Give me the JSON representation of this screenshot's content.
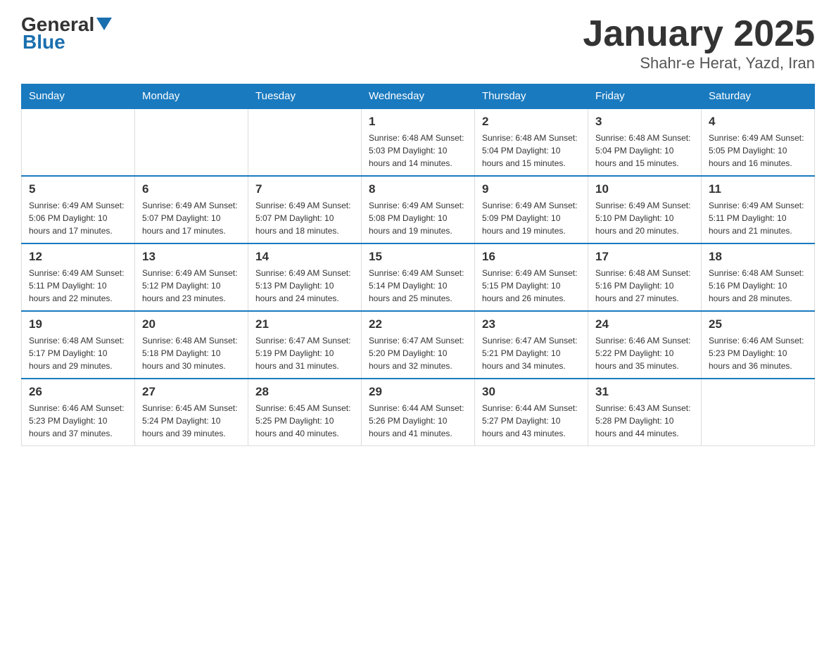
{
  "header": {
    "logo_general": "General",
    "logo_blue": "Blue",
    "title": "January 2025",
    "subtitle": "Shahr-e Herat, Yazd, Iran"
  },
  "weekdays": [
    "Sunday",
    "Monday",
    "Tuesday",
    "Wednesday",
    "Thursday",
    "Friday",
    "Saturday"
  ],
  "weeks": [
    [
      {
        "day": "",
        "info": ""
      },
      {
        "day": "",
        "info": ""
      },
      {
        "day": "",
        "info": ""
      },
      {
        "day": "1",
        "info": "Sunrise: 6:48 AM\nSunset: 5:03 PM\nDaylight: 10 hours\nand 14 minutes."
      },
      {
        "day": "2",
        "info": "Sunrise: 6:48 AM\nSunset: 5:04 PM\nDaylight: 10 hours\nand 15 minutes."
      },
      {
        "day": "3",
        "info": "Sunrise: 6:48 AM\nSunset: 5:04 PM\nDaylight: 10 hours\nand 15 minutes."
      },
      {
        "day": "4",
        "info": "Sunrise: 6:49 AM\nSunset: 5:05 PM\nDaylight: 10 hours\nand 16 minutes."
      }
    ],
    [
      {
        "day": "5",
        "info": "Sunrise: 6:49 AM\nSunset: 5:06 PM\nDaylight: 10 hours\nand 17 minutes."
      },
      {
        "day": "6",
        "info": "Sunrise: 6:49 AM\nSunset: 5:07 PM\nDaylight: 10 hours\nand 17 minutes."
      },
      {
        "day": "7",
        "info": "Sunrise: 6:49 AM\nSunset: 5:07 PM\nDaylight: 10 hours\nand 18 minutes."
      },
      {
        "day": "8",
        "info": "Sunrise: 6:49 AM\nSunset: 5:08 PM\nDaylight: 10 hours\nand 19 minutes."
      },
      {
        "day": "9",
        "info": "Sunrise: 6:49 AM\nSunset: 5:09 PM\nDaylight: 10 hours\nand 19 minutes."
      },
      {
        "day": "10",
        "info": "Sunrise: 6:49 AM\nSunset: 5:10 PM\nDaylight: 10 hours\nand 20 minutes."
      },
      {
        "day": "11",
        "info": "Sunrise: 6:49 AM\nSunset: 5:11 PM\nDaylight: 10 hours\nand 21 minutes."
      }
    ],
    [
      {
        "day": "12",
        "info": "Sunrise: 6:49 AM\nSunset: 5:11 PM\nDaylight: 10 hours\nand 22 minutes."
      },
      {
        "day": "13",
        "info": "Sunrise: 6:49 AM\nSunset: 5:12 PM\nDaylight: 10 hours\nand 23 minutes."
      },
      {
        "day": "14",
        "info": "Sunrise: 6:49 AM\nSunset: 5:13 PM\nDaylight: 10 hours\nand 24 minutes."
      },
      {
        "day": "15",
        "info": "Sunrise: 6:49 AM\nSunset: 5:14 PM\nDaylight: 10 hours\nand 25 minutes."
      },
      {
        "day": "16",
        "info": "Sunrise: 6:49 AM\nSunset: 5:15 PM\nDaylight: 10 hours\nand 26 minutes."
      },
      {
        "day": "17",
        "info": "Sunrise: 6:48 AM\nSunset: 5:16 PM\nDaylight: 10 hours\nand 27 minutes."
      },
      {
        "day": "18",
        "info": "Sunrise: 6:48 AM\nSunset: 5:16 PM\nDaylight: 10 hours\nand 28 minutes."
      }
    ],
    [
      {
        "day": "19",
        "info": "Sunrise: 6:48 AM\nSunset: 5:17 PM\nDaylight: 10 hours\nand 29 minutes."
      },
      {
        "day": "20",
        "info": "Sunrise: 6:48 AM\nSunset: 5:18 PM\nDaylight: 10 hours\nand 30 minutes."
      },
      {
        "day": "21",
        "info": "Sunrise: 6:47 AM\nSunset: 5:19 PM\nDaylight: 10 hours\nand 31 minutes."
      },
      {
        "day": "22",
        "info": "Sunrise: 6:47 AM\nSunset: 5:20 PM\nDaylight: 10 hours\nand 32 minutes."
      },
      {
        "day": "23",
        "info": "Sunrise: 6:47 AM\nSunset: 5:21 PM\nDaylight: 10 hours\nand 34 minutes."
      },
      {
        "day": "24",
        "info": "Sunrise: 6:46 AM\nSunset: 5:22 PM\nDaylight: 10 hours\nand 35 minutes."
      },
      {
        "day": "25",
        "info": "Sunrise: 6:46 AM\nSunset: 5:23 PM\nDaylight: 10 hours\nand 36 minutes."
      }
    ],
    [
      {
        "day": "26",
        "info": "Sunrise: 6:46 AM\nSunset: 5:23 PM\nDaylight: 10 hours\nand 37 minutes."
      },
      {
        "day": "27",
        "info": "Sunrise: 6:45 AM\nSunset: 5:24 PM\nDaylight: 10 hours\nand 39 minutes."
      },
      {
        "day": "28",
        "info": "Sunrise: 6:45 AM\nSunset: 5:25 PM\nDaylight: 10 hours\nand 40 minutes."
      },
      {
        "day": "29",
        "info": "Sunrise: 6:44 AM\nSunset: 5:26 PM\nDaylight: 10 hours\nand 41 minutes."
      },
      {
        "day": "30",
        "info": "Sunrise: 6:44 AM\nSunset: 5:27 PM\nDaylight: 10 hours\nand 43 minutes."
      },
      {
        "day": "31",
        "info": "Sunrise: 6:43 AM\nSunset: 5:28 PM\nDaylight: 10 hours\nand 44 minutes."
      },
      {
        "day": "",
        "info": ""
      }
    ]
  ]
}
